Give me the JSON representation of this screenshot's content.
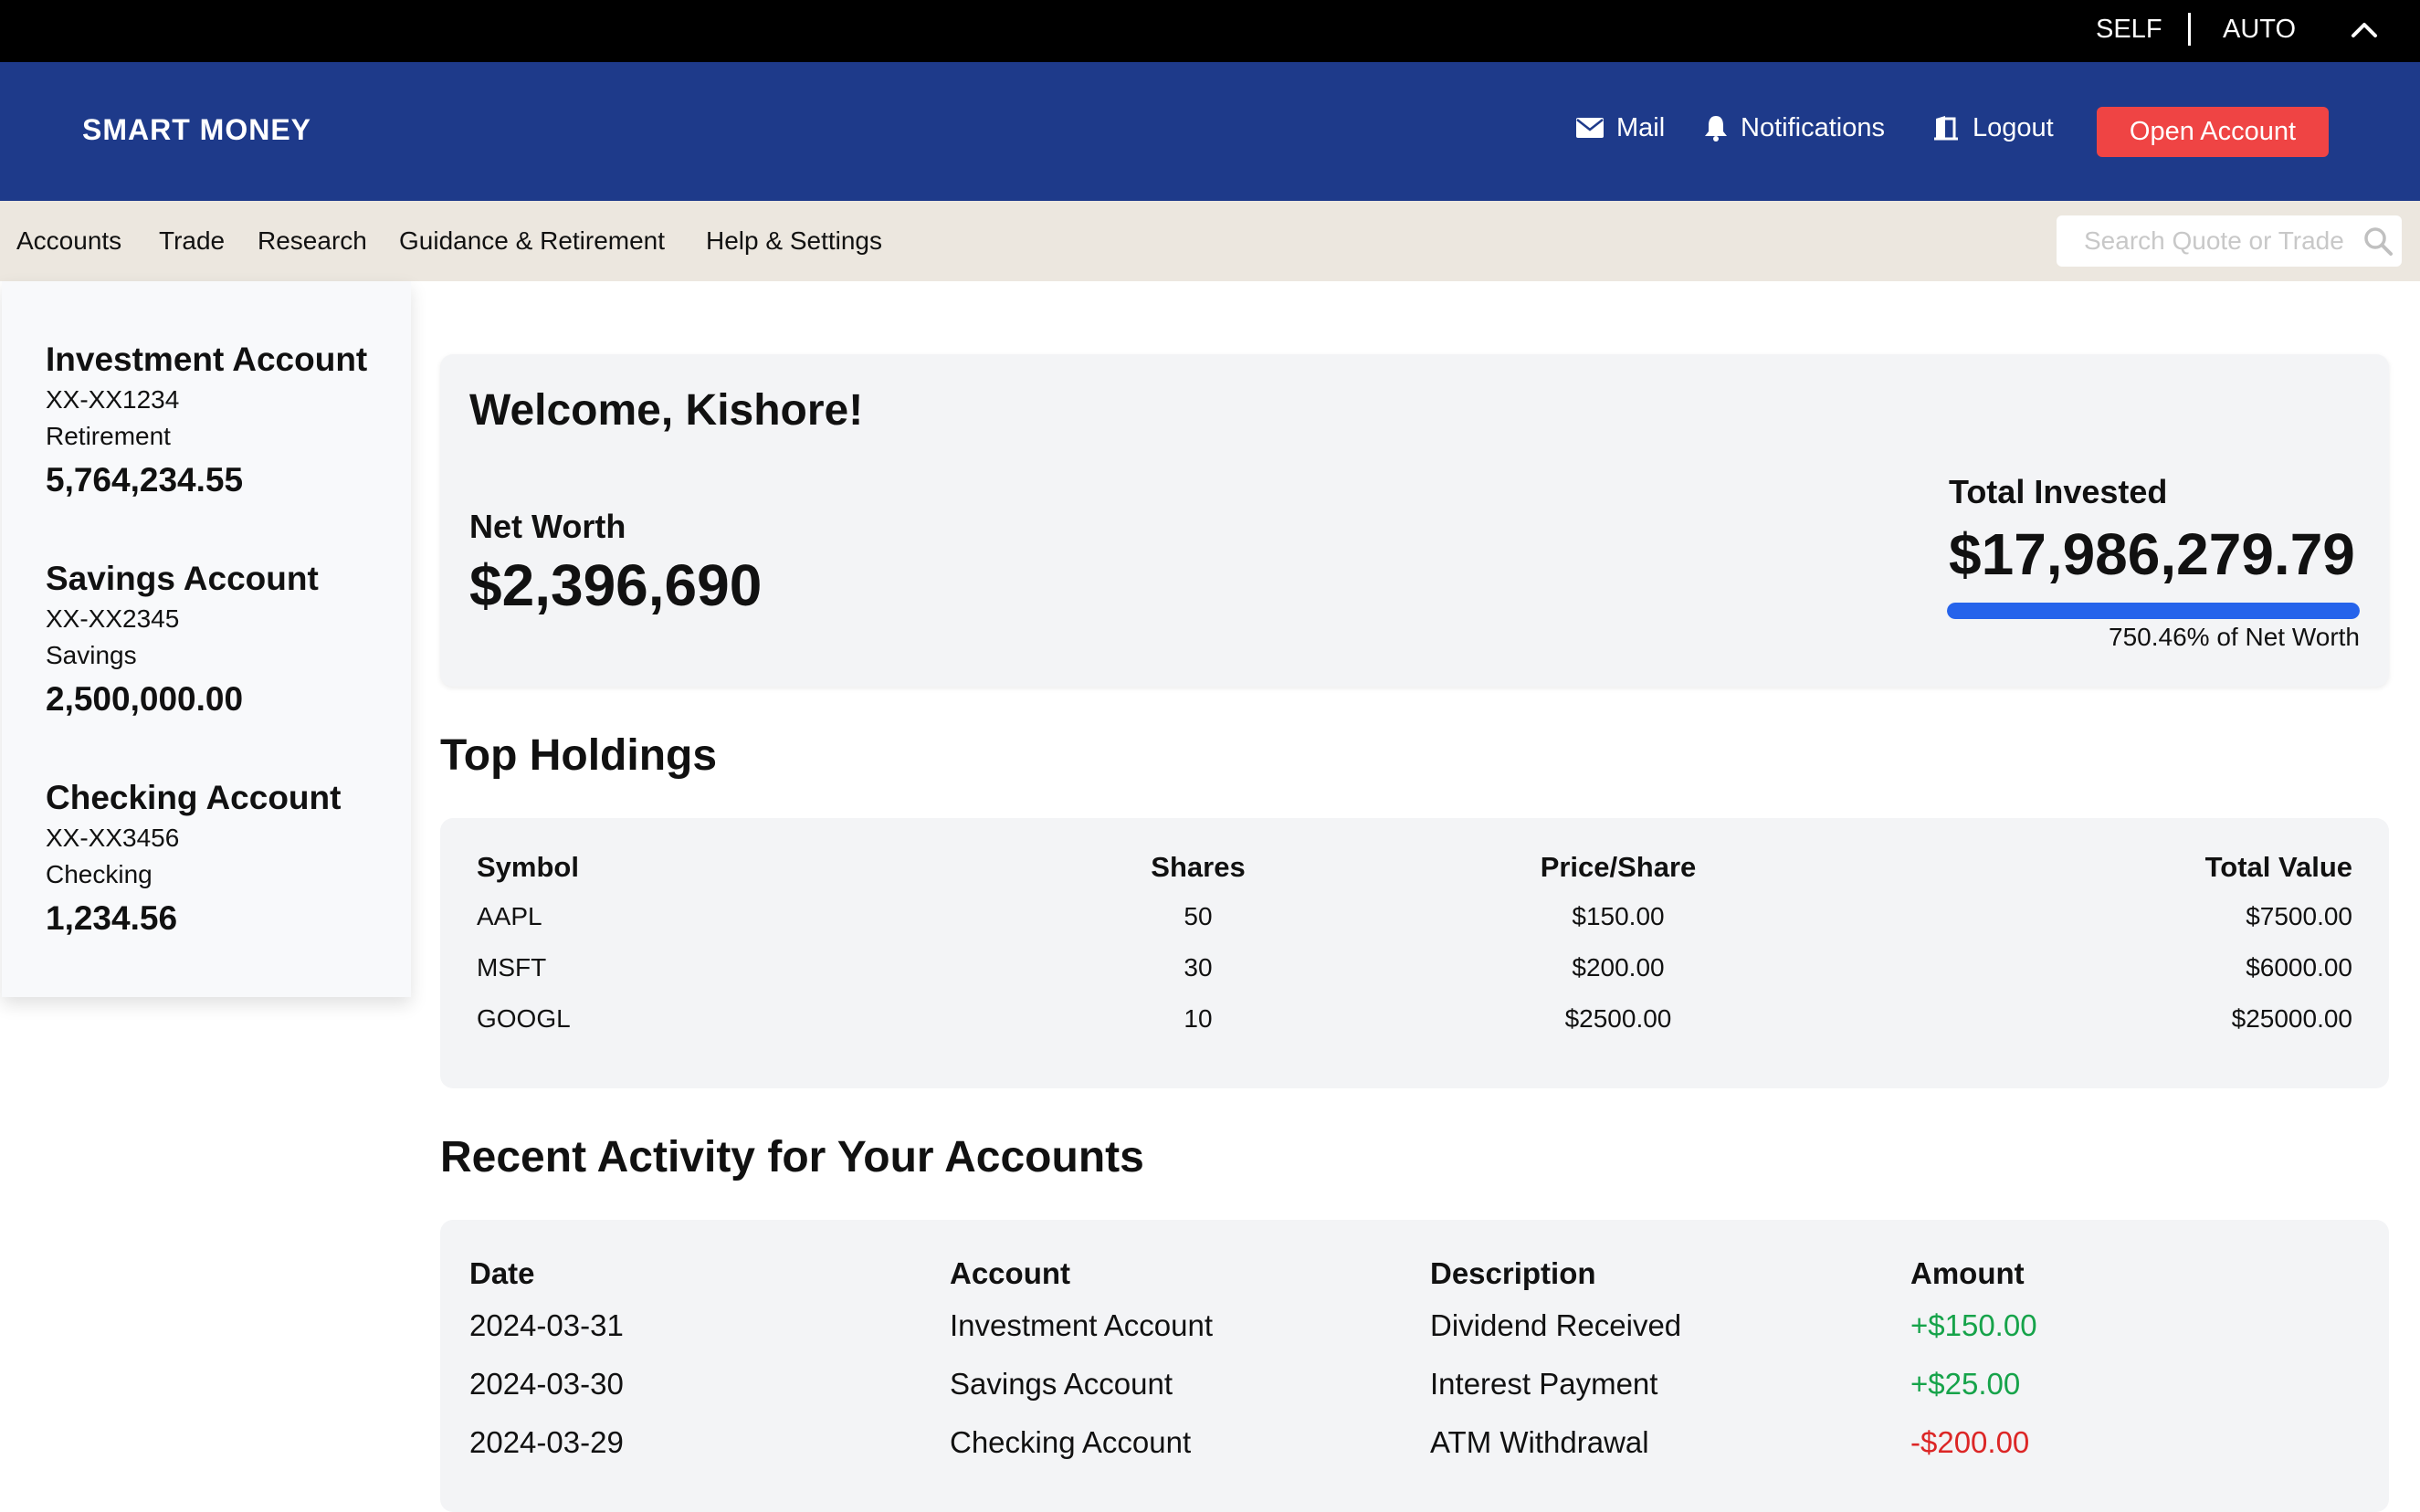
{
  "topbar": {
    "self_label": "SELF",
    "auto_label": "AUTO",
    "collapse_icon": "chevron-up-icon"
  },
  "header": {
    "logo": "SMART MONEY",
    "mail_label": "Mail",
    "notifications_label": "Notifications",
    "logout_label": "Logout",
    "open_account_label": "Open Account",
    "colors": {
      "header_bg": "#1e3a8a",
      "button_bg": "#ef4444"
    }
  },
  "nav": {
    "items": [
      "Accounts",
      "Trade",
      "Research",
      "Guidance & Retirement",
      "Help & Settings"
    ],
    "search_placeholder": "Search Quote or Trade"
  },
  "sidebar": {
    "accounts": [
      {
        "name": "Investment Account",
        "number": "XX-XX1234",
        "type": "Retirement",
        "balance": "5,764,234.55"
      },
      {
        "name": "Savings Account",
        "number": "XX-XX2345",
        "type": "Savings",
        "balance": "2,500,000.00"
      },
      {
        "name": "Checking Account",
        "number": "XX-XX3456",
        "type": "Checking",
        "balance": "1,234.56"
      }
    ]
  },
  "welcome": {
    "title": "Welcome, Kishore!",
    "net_worth_label": "Net Worth",
    "net_worth_value": "$2,396,690",
    "total_invested_label": "Total Invested",
    "total_invested_value": "$17,986,279.79",
    "progress_fill_percent": 100,
    "progress_text": "750.46% of Net Worth",
    "progress_color": "#2563eb"
  },
  "holdings": {
    "title": "Top Holdings",
    "headers": [
      "Symbol",
      "Shares",
      "Price/Share",
      "Total Value"
    ],
    "rows": [
      [
        "AAPL",
        "50",
        "$150.00",
        "$7500.00"
      ],
      [
        "MSFT",
        "30",
        "$200.00",
        "$6000.00"
      ],
      [
        "GOOGL",
        "10",
        "$2500.00",
        "$25000.00"
      ]
    ]
  },
  "activity": {
    "title": "Recent Activity for Your Accounts",
    "headers": [
      "Date",
      "Account",
      "Description",
      "Amount"
    ],
    "rows": [
      [
        "2024-03-31",
        "Investment Account",
        "Dividend Received",
        "+$150.00"
      ],
      [
        "2024-03-30",
        "Savings Account",
        "Interest Payment",
        "+$25.00"
      ],
      [
        "2024-03-29",
        "Checking Account",
        "ATM Withdrawal",
        "-$200.00"
      ]
    ],
    "colors": {
      "positive": "#16a34a",
      "negative": "#dc2626"
    }
  }
}
